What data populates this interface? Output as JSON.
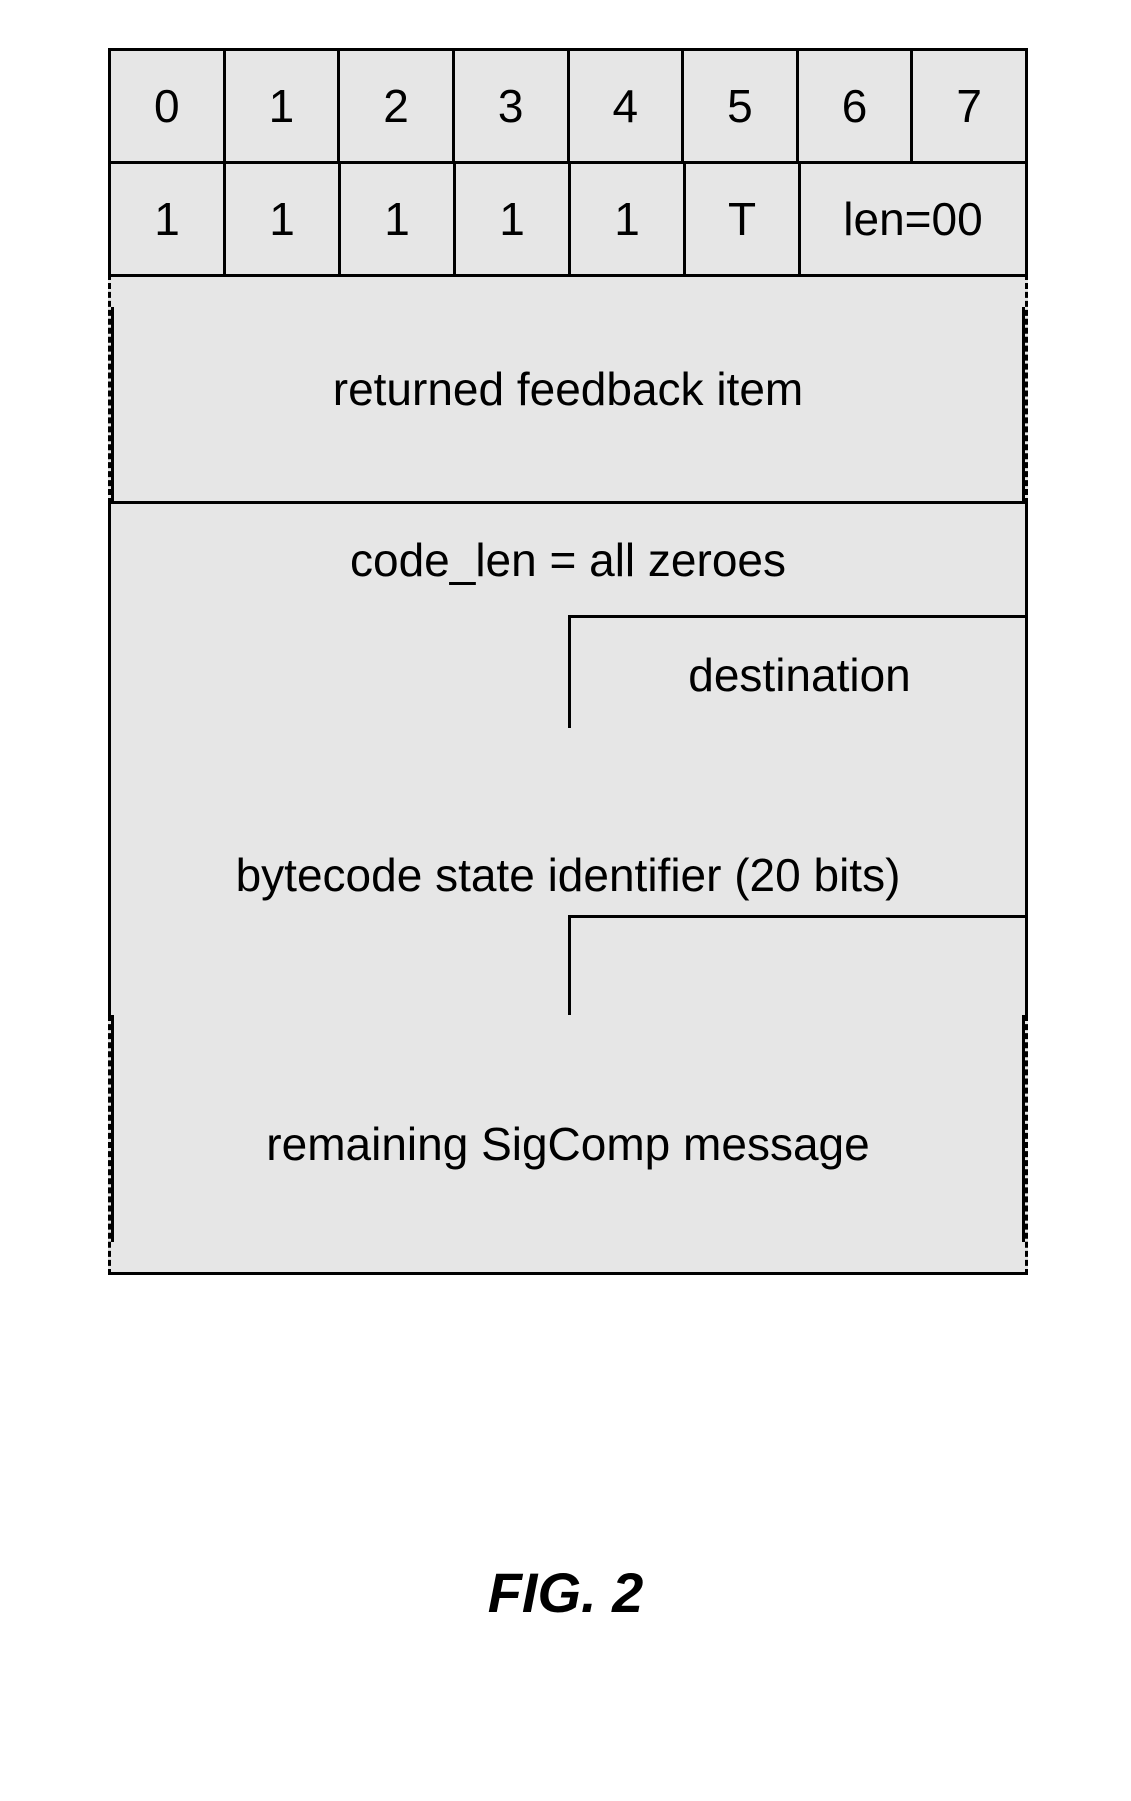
{
  "header_bits": [
    "0",
    "1",
    "2",
    "3",
    "4",
    "5",
    "6",
    "7"
  ],
  "row2": {
    "bits": [
      "1",
      "1",
      "1",
      "1",
      "1",
      "T"
    ],
    "len": "len=00"
  },
  "feedback": "returned feedback item",
  "code_len": "code_len = all zeroes",
  "destination": "destination",
  "bytecode": "bytecode state identifier (20 bits)",
  "remaining": "remaining SigComp message",
  "caption": "FIG. 2"
}
